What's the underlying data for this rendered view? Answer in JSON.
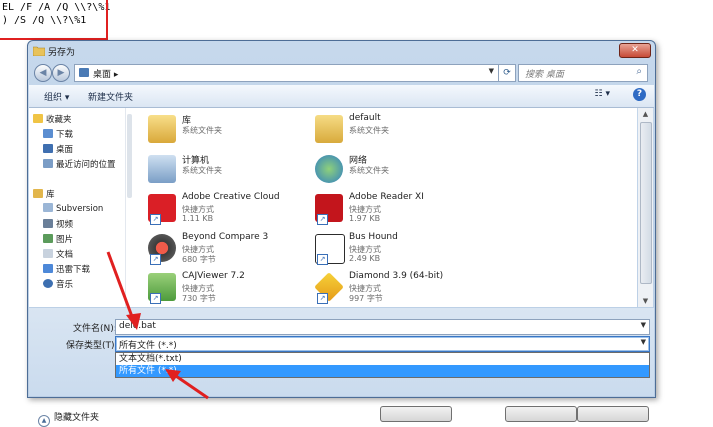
{
  "code": {
    "line1": "EL /F /A /Q \\\\?\\%1",
    "line2": ") /S /Q \\\\?\\%1"
  },
  "dialog": {
    "title": "另存为",
    "close": "✕"
  },
  "address": {
    "path": "桌面",
    "separator": "▸",
    "search_placeholder": "搜索 桌面"
  },
  "toolbar": {
    "organize": "组织 ▾",
    "new_folder": "新建文件夹",
    "view": "☷ ▾",
    "help": "?"
  },
  "nav": {
    "favorites_header": "收藏夹",
    "favorites": [
      "下载",
      "桌面",
      "最近访问的位置"
    ],
    "library_header": "库",
    "library": [
      "Subversion",
      "视频",
      "图片",
      "文档",
      "迅雷下载",
      "音乐"
    ]
  },
  "files": [
    {
      "name": "库",
      "type": "系统文件夹",
      "size": ""
    },
    {
      "name": "default",
      "type": "系统文件夹",
      "size": ""
    },
    {
      "name": "计算机",
      "type": "系统文件夹",
      "size": ""
    },
    {
      "name": "网络",
      "type": "系统文件夹",
      "size": ""
    },
    {
      "name": "Adobe Creative Cloud",
      "type": "快捷方式",
      "size": "1.11 KB"
    },
    {
      "name": "Adobe Reader XI",
      "type": "快捷方式",
      "size": "1.97 KB"
    },
    {
      "name": "Beyond Compare 3",
      "type": "快捷方式",
      "size": "680 字节"
    },
    {
      "name": "Bus Hound",
      "type": "快捷方式",
      "size": "2.49 KB"
    },
    {
      "name": "CAJViewer 7.2",
      "type": "快捷方式",
      "size": "730 字节"
    },
    {
      "name": "Diamond 3.9 (64-bit)",
      "type": "快捷方式",
      "size": "997 字节"
    }
  ],
  "form": {
    "filename_label": "文件名(N):",
    "filename_value": "dele.bat",
    "type_label": "保存类型(T):",
    "type_value": "所有文件 (*.*)",
    "type_options": [
      "文本文档(*.txt)",
      "所有文件 (*.*)"
    ],
    "hide_folders": "隐藏文件夹"
  },
  "colors": {
    "accent": "#3399ff",
    "arrow": "#e02020"
  }
}
